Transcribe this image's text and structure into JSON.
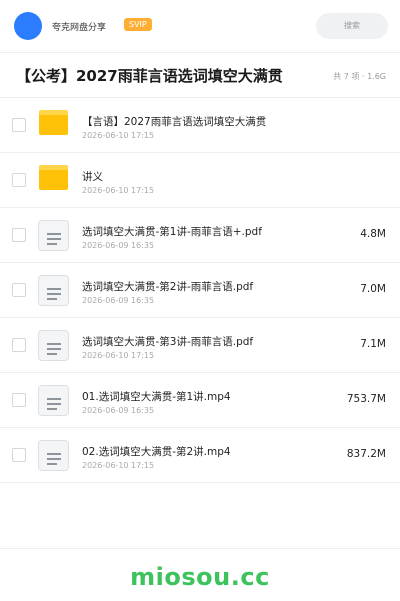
{
  "header": {
    "app_name": "夸克网盘分享",
    "badge": "SVIP",
    "search_placeholder": "搜索"
  },
  "folder": {
    "title": "【公考】2027雨菲言语选词填空大满贯",
    "meta": "共 7 项 · 1.6G"
  },
  "files": [
    {
      "name": "【言语】2027雨菲言语选词填空大满贯",
      "date": "2026-06-10 17:15",
      "size": "",
      "type": "folder"
    },
    {
      "name": "讲义",
      "date": "2026-06-10 17:15",
      "size": "",
      "type": "folder"
    },
    {
      "name": "选词填空大满贯-第1讲-雨菲言语+.pdf",
      "date": "2026-06-09 16:35",
      "size": "4.8M",
      "type": "doc"
    },
    {
      "name": "选词填空大满贯-第2讲-雨菲言语.pdf",
      "date": "2026-06-09 16:35",
      "size": "7.0M",
      "type": "doc"
    },
    {
      "name": "选词填空大满贯-第3讲-雨菲言语.pdf",
      "date": "2026-06-10 17:15",
      "size": "7.1M",
      "type": "doc"
    },
    {
      "name": "01.选词填空大满贯-第1讲.mp4",
      "date": "2026-06-09 16:35",
      "size": "753.7M",
      "type": "doc"
    },
    {
      "name": "02.选词填空大满贯-第2讲.mp4",
      "date": "2026-06-10 17:15",
      "size": "837.2M",
      "type": "doc"
    }
  ],
  "footer": {
    "watermark": "miosou.cc"
  }
}
